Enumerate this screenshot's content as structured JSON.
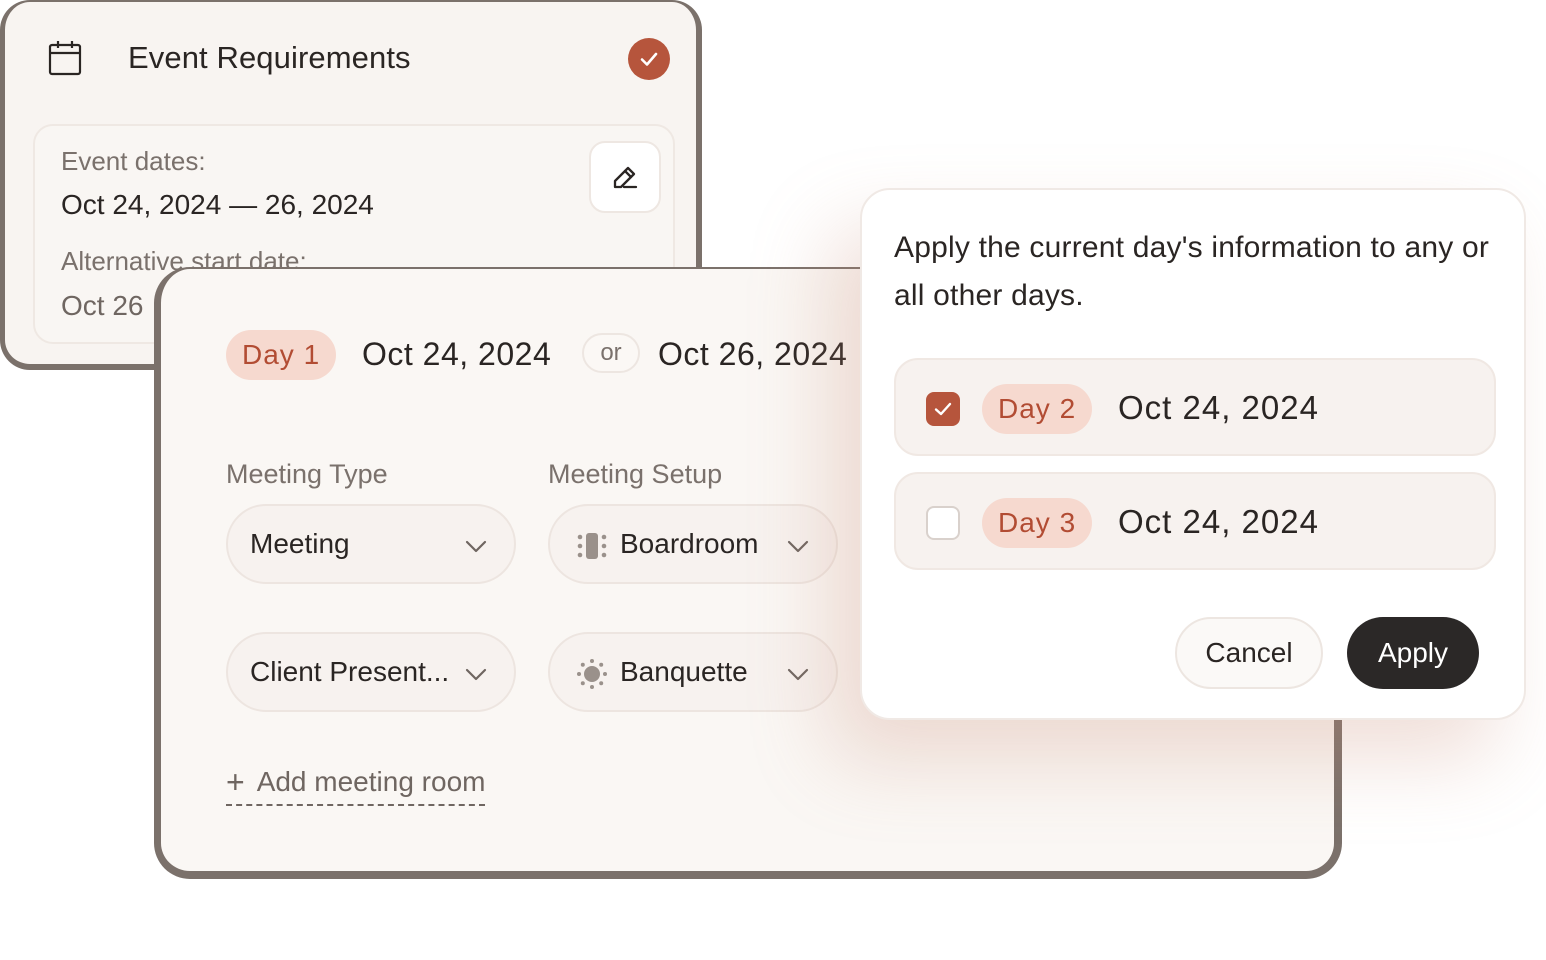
{
  "requirements_card": {
    "title": "Event Requirements",
    "icon": "calendar-icon",
    "status_icon": "check-circle-icon",
    "event_dates_label": "Event dates:",
    "event_dates_value": "Oct 24, 2024 — 26, 2024",
    "alt_start_label": "Alternative start date:",
    "alt_start_value": "Oct 26",
    "edit_icon": "pencil-edit-icon"
  },
  "day_card": {
    "day_badge": "Day 1",
    "date": "Oct 24, 2024",
    "or_label": "or",
    "alt_date": "Oct 26, 2024",
    "meeting_type_label": "Meeting Type",
    "meeting_setup_label": "Meeting Setup",
    "rows": [
      {
        "type": "Meeting",
        "setup": "Boardroom",
        "setup_icon": "boardroom-table-icon"
      },
      {
        "type": "Client Present...",
        "setup": "Banquette",
        "setup_icon": "banquet-round-table-icon"
      }
    ],
    "add_room_label": "Add meeting room"
  },
  "popover": {
    "message": "Apply the current day's information to any or all other days.",
    "options": [
      {
        "day": "Day 2",
        "date": "Oct 24, 2024",
        "checked": true
      },
      {
        "day": "Day 3",
        "date": "Oct 24, 2024",
        "checked": false
      }
    ],
    "cancel_label": "Cancel",
    "apply_label": "Apply"
  },
  "colors": {
    "accent": "#b6553c",
    "pill_bg": "#f6d9cf",
    "dark_button": "#2b2827",
    "frame": "#7b716b"
  }
}
